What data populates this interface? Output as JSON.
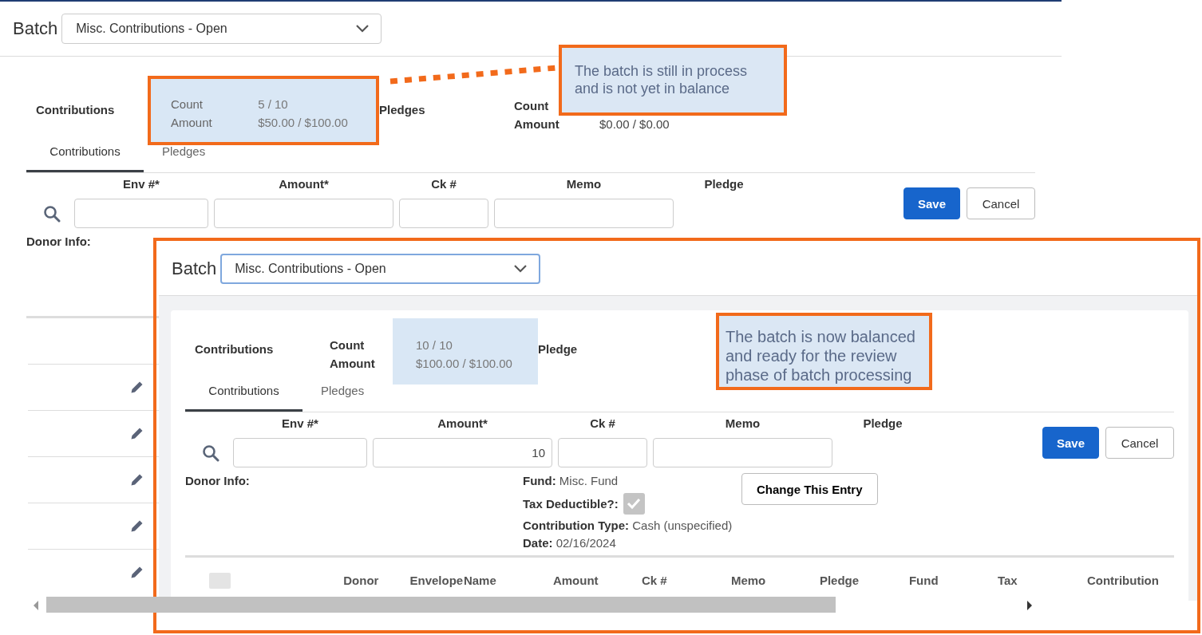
{
  "screens": [
    {
      "kind": "back",
      "batch": {
        "label": "Batch",
        "selected": "Misc. Contributions - Open",
        "focused": false
      },
      "summary": {
        "contributions_label": "Contributions",
        "count_label": "Count",
        "count_value": "5 / 10",
        "amount_label": "Amount",
        "amount_value": "$50.00 / $100.00",
        "outlined": true,
        "highlighted": false,
        "pledges_label": "Pledges",
        "pledge_count_label": "Count",
        "pledge_amount_label": "Amount",
        "pledge_amount_value": "$0.00 / $0.00"
      },
      "tabs": [
        {
          "label": "Contributions",
          "selected": true
        },
        {
          "label": "Pledges",
          "selected": false
        }
      ],
      "fields": [
        {
          "label": "Env #*",
          "kind": "input"
        },
        {
          "label": "Amount*",
          "kind": "input"
        },
        {
          "label": "Ck #",
          "kind": "input"
        },
        {
          "label": "Memo",
          "kind": "input"
        },
        {
          "label": "Pledge",
          "kind": "label"
        }
      ],
      "buttons": [
        {
          "label": "Save",
          "kind": "primary"
        },
        {
          "label": "Cancel",
          "kind": "secondary"
        }
      ],
      "donor_info_label": "Donor Info:",
      "rows": [
        {
          "kind": "editable"
        },
        {
          "kind": "editable"
        },
        {
          "kind": "editable"
        },
        {
          "kind": "editable"
        },
        {
          "kind": "editable"
        }
      ]
    },
    {
      "kind": "inset",
      "batch": {
        "label": "Batch",
        "selected": "Misc. Contributions - Open",
        "focused": true
      },
      "summary": {
        "contributions_label": "Contributions",
        "count_label": "Count",
        "count_value": "10 / 10",
        "amount_label": "Amount",
        "amount_value": "$100.00 / $100.00",
        "outlined": false,
        "highlighted": true,
        "pledges_label": "Pledge"
      },
      "tabs": [
        {
          "label": "Contributions",
          "selected": true
        },
        {
          "label": "Pledges",
          "selected": false
        }
      ],
      "fields": [
        {
          "label": "Env #*",
          "kind": "input"
        },
        {
          "label": "Amount*",
          "kind": "input",
          "value": "10"
        },
        {
          "label": "Ck #",
          "kind": "input"
        },
        {
          "label": "Memo",
          "kind": "input"
        },
        {
          "label": "Pledge",
          "kind": "label"
        }
      ],
      "buttons": [
        {
          "label": "Save",
          "kind": "primary"
        },
        {
          "label": "Cancel",
          "kind": "secondary"
        }
      ],
      "donor_info_label": "Donor Info:",
      "details": [
        {
          "kind": "text",
          "label": "Fund:",
          "value": "Misc. Fund"
        },
        {
          "kind": "checkbox",
          "label": "Tax Deductible?:",
          "checked": true,
          "disabled": true
        },
        {
          "kind": "text",
          "label": "Contribution Type:",
          "value": "Cash (unspecified)"
        },
        {
          "kind": "text",
          "label": "Date:",
          "value": "02/16/2024"
        }
      ],
      "change_button": "Change This Entry",
      "table": {
        "select_all": {
          "checked": false
        },
        "columns": [
          "Donor",
          "Envelope",
          "Name",
          "Amount",
          "Ck #",
          "Memo",
          "Pledge",
          "Fund",
          "Tax",
          "Contribution"
        ]
      }
    }
  ],
  "callouts": [
    {
      "text": "The batch is still in process\nand is not yet in balance"
    },
    {
      "text": "The batch is now balanced\nand ready for the review\nphase of batch processing"
    }
  ]
}
